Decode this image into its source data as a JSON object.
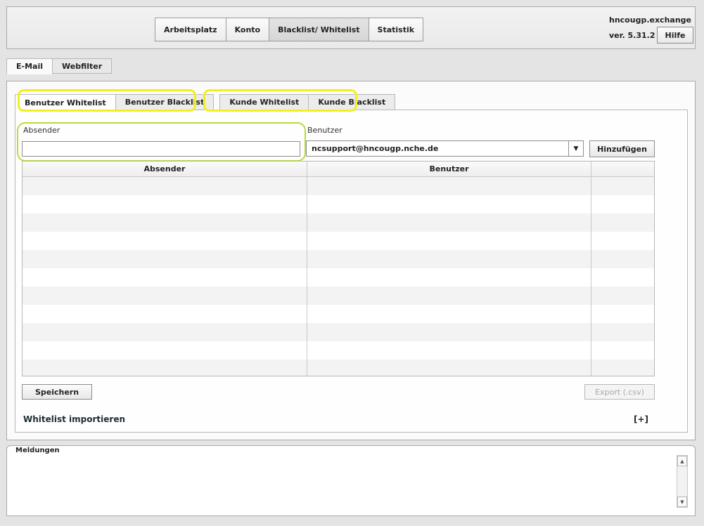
{
  "header": {
    "nav": [
      "Arbeitsplatz",
      "Konto",
      "Blacklist/ Whitelist",
      "Statistik"
    ],
    "app_name": "hncougp.exchange",
    "version": "ver. 5.31.2",
    "help_label": "Hilfe"
  },
  "outer_tabs": [
    "E-Mail",
    "Webfilter"
  ],
  "inner_tabs": [
    "Benutzer Whitelist",
    "Benutzer Blacklist",
    "Kunde Whitelist",
    "Kunde Blacklist"
  ],
  "form": {
    "sender_label": "Absender",
    "sender_value": "",
    "user_label": "Benutzer",
    "user_value": "ncsupport@hncougp.nche.de",
    "add_label": "Hinzufügen"
  },
  "table": {
    "columns": [
      "Absender",
      "Benutzer",
      ""
    ]
  },
  "actions": {
    "save_label": "Speichern",
    "export_label": "Export (.csv)"
  },
  "import": {
    "title": "Whitelist importieren",
    "toggle": "[+]"
  },
  "messages": {
    "title": "Meldungen"
  }
}
